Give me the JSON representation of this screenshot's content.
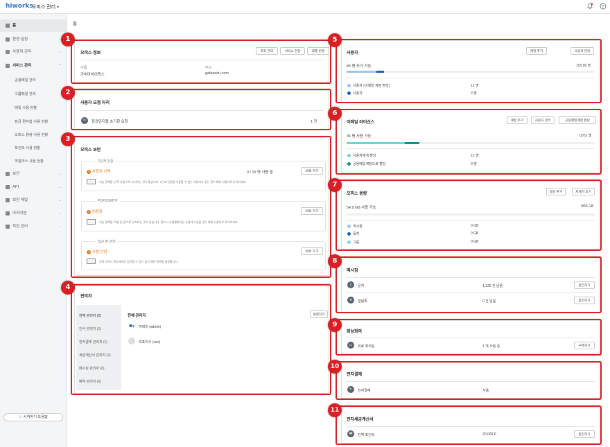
{
  "topbar": {
    "logo": "hiworks",
    "app_title": "오피스 관리",
    "bell_icon": "bell-icon",
    "help_icon": "help-icon"
  },
  "sidebar": {
    "items": [
      {
        "label": "홈",
        "icon": "home-icon",
        "selected": true
      },
      {
        "label": "환경 설정",
        "icon": "gear-icon"
      },
      {
        "label": "사용자 관리",
        "icon": "user-icon"
      },
      {
        "label": "서비스 관리",
        "icon": "chart-icon",
        "expanded": true
      },
      {
        "label": "보안",
        "icon": "lock-icon"
      },
      {
        "label": "API",
        "icon": "api-icon"
      },
      {
        "label": "보안 메일",
        "icon": "mail-lock-icon"
      },
      {
        "label": "아카이빙",
        "icon": "archive-icon"
      },
      {
        "label": "작업 관리",
        "icon": "task-icon"
      }
    ],
    "sub_items": [
      "공용메일 관리",
      "그룹메일 관리",
      "메일 사용 현황",
      "장금 편지함 사용 현황",
      "오피스 용량 사용 현황",
      "포인트 사용 현황",
      "파일박스 사용 현황"
    ],
    "start_button": "시작하기 도움말"
  },
  "page": {
    "title": "홈"
  },
  "badges": [
    "1",
    "2",
    "3",
    "4",
    "5",
    "6",
    "7",
    "8",
    "9",
    "10",
    "11"
  ],
  "office_info": {
    "title": "오피스 정보",
    "buttons": [
      "조직 관리",
      "서비스 연장",
      "대행 변경"
    ],
    "name_label": "이름",
    "name_value": "가비아하이웍스",
    "addr_label": "주소",
    "addr_value": "gabiaedu.com"
  },
  "user_request": {
    "title": "사용자 요청 처리",
    "item": "잠겼던지을 초기화 요청",
    "count": "1 건"
  },
  "security": {
    "title": "오피스 보안",
    "sections": [
      {
        "legend": "2단계 인증",
        "status": "사용자 선택",
        "value": "0 / 15 명 사용 중",
        "button": "바로 가기",
        "desc": "기능 정책을 '선택 사용'으로 유지하는 것이 좋습니다. 2단계 인증을 사용할 수 없는 사용자가 있는 경우 예외 사용자로 추가하세요."
      },
      {
        "legend": "POP3/SMTP",
        "status": "허용함",
        "value": "",
        "button": "바로 가기",
        "desc": "기능 정책을 '허용 안 함'으로 유지하는 것이 좋습니다. 반드시 사용해야하는 사용자가 있을 경우 예외 사용자로 추가하세요."
      },
      {
        "legend": "접근 IP 관리",
        "status": "사용 안함",
        "value": "",
        "button": "바로 가기",
        "desc": "지정 국가나 정소에서만 접근할 수 있는 접근 제한 정책을 권장합니다."
      }
    ]
  },
  "admin": {
    "title": "관리자",
    "tabs": [
      "전체 관리자 (2)",
      "인사 관리자 (1)",
      "전자결재 관리자 (1)",
      "세금계산서 관리자 (2)",
      "메시징 관리자 (0)",
      "예약 관리자 (0)"
    ],
    "list_title": "전체 관리자",
    "set_button": "설정하기",
    "admins": [
      "여대리 (admin)",
      "대표이사 (ceo)"
    ]
  },
  "users": {
    "title": "사용자",
    "buttons": [
      "계정 추가",
      "사용자 관리"
    ],
    "capacity_label": "85 명 추가 가능",
    "capacity_value": "15/100 명",
    "rows": [
      {
        "label": "사용자 (이메일 계정 할당)",
        "value": "12 명",
        "color": "#9cc4ec"
      },
      {
        "label": "사용자",
        "value": "3 명",
        "color": "#1f5fb8"
      }
    ],
    "used_fraction": 0.15,
    "seg1_fraction": 0.12
  },
  "email_license": {
    "title": "이메일 라이선스",
    "buttons": [
      "계정 추가",
      "사용자 관리",
      "공용메일계정 할당"
    ],
    "capacity_label": "36 명 사용 가능",
    "capacity_value": "15/51 명",
    "rows": [
      {
        "label": "사용자에게 할당",
        "value": "12 명",
        "color": "#6fd2d6"
      },
      {
        "label": "공용메일계정으로 할당",
        "value": "3 명",
        "color": "#178c8a"
      }
    ],
    "used_fraction": 0.294,
    "seg1_fraction": 0.235
  },
  "storage": {
    "title": "오피스 용량",
    "buttons": [
      "용량 추가",
      "자세히 보기"
    ],
    "capacity_label": "54.9 GB 사용 가능",
    "capacity_value": "0/55 GB",
    "rows": [
      {
        "label": "게시판",
        "value": "0 GB",
        "color": "#9cc4ec"
      },
      {
        "label": "폭지",
        "value": "0 GB",
        "color": "#1f5fb8"
      },
      {
        "label": "그룹",
        "value": "0 GB",
        "color": "#7fd6e0"
      }
    ]
  },
  "messaging": {
    "title": "메시징",
    "rows": [
      {
        "label": "문자",
        "value": "1,125 건 남음",
        "button": "충전하기",
        "icon": "sms-icon"
      },
      {
        "label": "알림톡",
        "value": "0 건 남음",
        "button": "충전하기",
        "icon": "chat-icon"
      }
    ]
  },
  "video": {
    "title": "화상회의",
    "row": {
      "label": "유료 회의실",
      "value": "1 개 사용 중",
      "button": "구매하기",
      "icon": "monitor-icon"
    }
  },
  "approval": {
    "title": "전자결재",
    "row": {
      "label": "전자결재",
      "value": "사용",
      "icon": "approval-icon"
    }
  },
  "tax": {
    "title": "전자세금계산서",
    "row": {
      "label": "잔여 포인트",
      "value": "20,000 P",
      "button": "충전하기",
      "icon": "point-icon"
    }
  },
  "colors": {
    "highlight": "#d91e24",
    "accent": "#3a78c8",
    "warning": "#e07b24"
  }
}
